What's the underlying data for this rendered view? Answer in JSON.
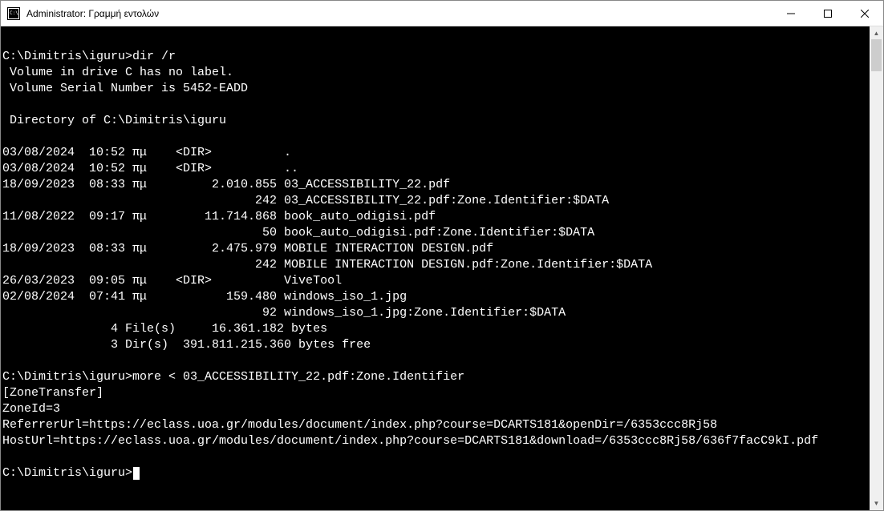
{
  "window": {
    "title": "Administrator: Γραμμή εντολών"
  },
  "terminal": {
    "lines": [
      "",
      "C:\\Dimitris\\iguru>dir /r",
      " Volume in drive C has no label.",
      " Volume Serial Number is 5452-EADD",
      "",
      " Directory of C:\\Dimitris\\iguru",
      "",
      "03/08/2024  10:52 πμ    <DIR>          .",
      "03/08/2024  10:52 πμ    <DIR>          ..",
      "18/09/2023  08:33 πμ         2.010.855 03_ACCESSIBILITY_22.pdf",
      "                                   242 03_ACCESSIBILITY_22.pdf:Zone.Identifier:$DATA",
      "11/08/2022  09:17 πμ        11.714.868 book_auto_odigisi.pdf",
      "                                    50 book_auto_odigisi.pdf:Zone.Identifier:$DATA",
      "18/09/2023  08:33 πμ         2.475.979 MOBILE INTERACTION DESIGN.pdf",
      "                                   242 MOBILE INTERACTION DESIGN.pdf:Zone.Identifier:$DATA",
      "26/03/2023  09:05 πμ    <DIR>          ViveTool",
      "02/08/2024  07:41 πμ           159.480 windows_iso_1.jpg",
      "                                    92 windows_iso_1.jpg:Zone.Identifier:$DATA",
      "               4 File(s)     16.361.182 bytes",
      "               3 Dir(s)  391.811.215.360 bytes free",
      "",
      "C:\\Dimitris\\iguru>more < 03_ACCESSIBILITY_22.pdf:Zone.Identifier",
      "[ZoneTransfer]",
      "ZoneId=3",
      "ReferrerUrl=https://eclass.uoa.gr/modules/document/index.php?course=DCARTS181&openDir=/6353ccc8Rj58",
      "HostUrl=https://eclass.uoa.gr/modules/document/index.php?course=DCARTS181&download=/6353ccc8Rj58/636f7facC9kI.pdf",
      "",
      "C:\\Dimitris\\iguru>"
    ],
    "prompt_cursor_line_index": 27
  }
}
